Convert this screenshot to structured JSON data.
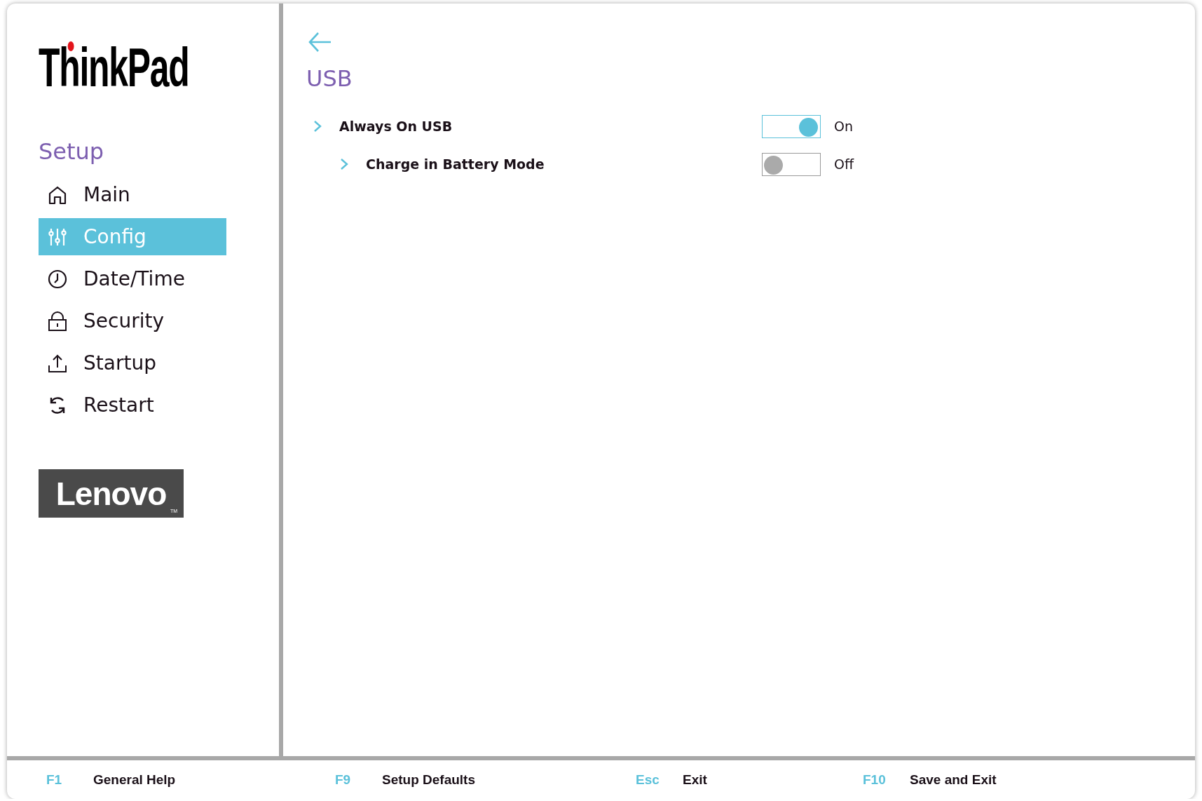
{
  "logo": {
    "brand": "ThinkPad"
  },
  "sidebar": {
    "title": "Setup",
    "items": [
      {
        "label": "Main",
        "selected": false
      },
      {
        "label": "Config",
        "selected": true
      },
      {
        "label": "Date/Time",
        "selected": false
      },
      {
        "label": "Security",
        "selected": false
      },
      {
        "label": "Startup",
        "selected": false
      },
      {
        "label": "Restart",
        "selected": false
      }
    ]
  },
  "vendor_logo": {
    "text": "Lenovo",
    "mark": "TM"
  },
  "page": {
    "title": "USB",
    "settings": [
      {
        "label": "Always On USB",
        "on": true,
        "value": "On",
        "children": [
          {
            "label": "Charge in Battery Mode",
            "on": false,
            "value": "Off"
          }
        ]
      }
    ]
  },
  "footer": {
    "keys": [
      {
        "key": "F1",
        "action": "General Help"
      },
      {
        "key": "F9",
        "action": "Setup Defaults"
      },
      {
        "key": "Esc",
        "action": "Exit"
      },
      {
        "key": "F10",
        "action": "Save and Exit"
      }
    ]
  }
}
